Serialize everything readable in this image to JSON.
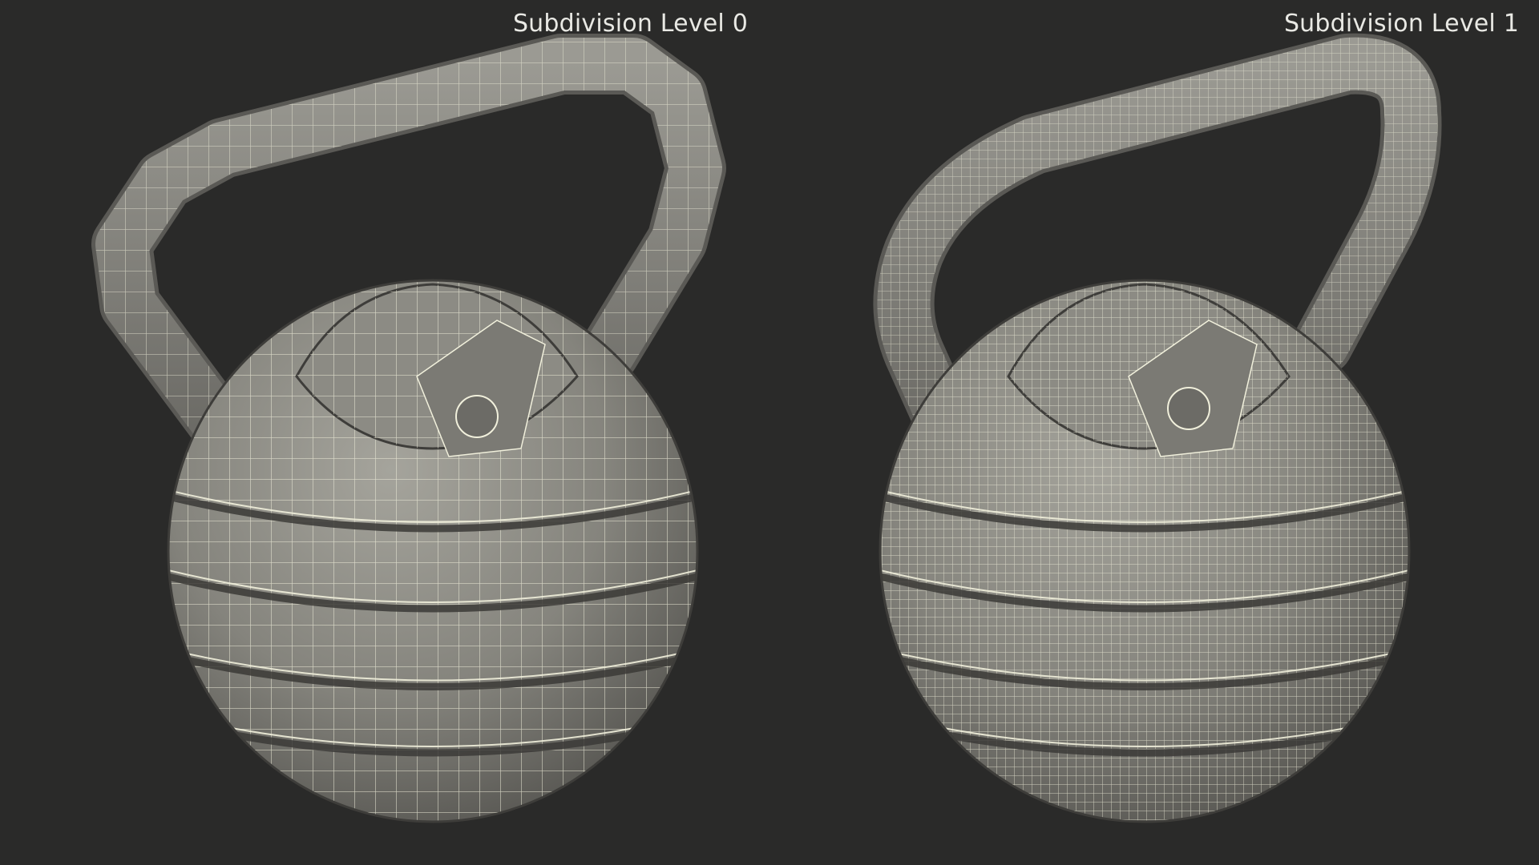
{
  "labels": {
    "left": "Subdivision Level 0",
    "right": "Subdivision Level 1"
  },
  "colors": {
    "background": "#2a2a29",
    "surface": "#7e7d77",
    "surface_light": "#a09f98",
    "surface_dark": "#4f4e4a",
    "wire": "#f1f0dc"
  }
}
